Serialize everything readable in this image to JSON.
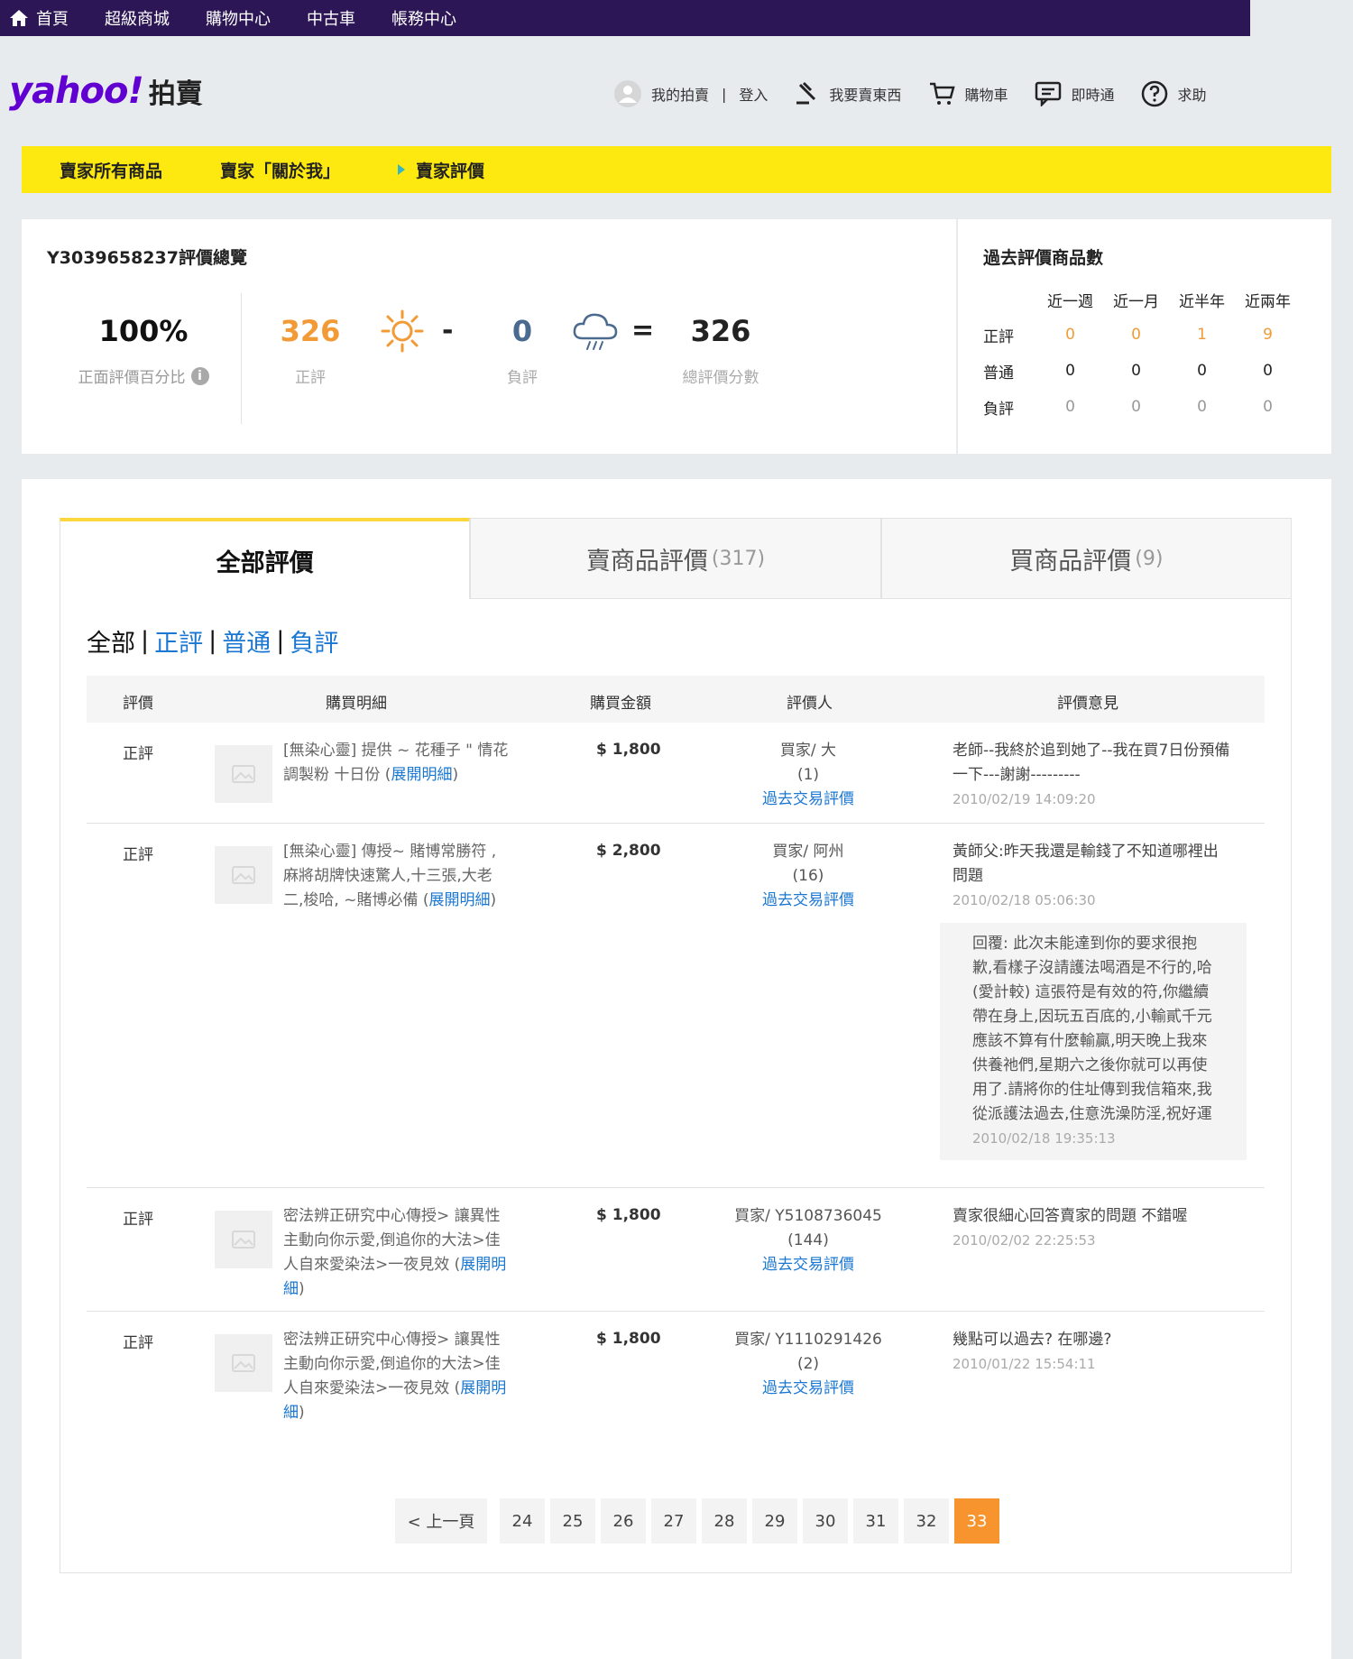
{
  "topnav": {
    "items": [
      "首頁",
      "超級商城",
      "購物中心",
      "中古車",
      "帳務中心"
    ]
  },
  "header": {
    "logo_text": "yahoo!",
    "logo_sub": "拍賣",
    "my_auction": "我的拍賣",
    "login": "登入",
    "sell": "我要賣東西",
    "cart": "購物車",
    "chat": "即時通",
    "help": "求助"
  },
  "seller_nav": {
    "items": [
      "賣家所有商品",
      "賣家「關於我」",
      "賣家評價"
    ]
  },
  "summary": {
    "title": "Y3039658237評價總覽",
    "percent": "100%",
    "percent_label": "正面評價百分比",
    "positive": "326",
    "positive_label": "正評",
    "minus": "-",
    "negative": "0",
    "negative_label": "負評",
    "equals": "=",
    "total": "326",
    "total_label": "總評價分數",
    "accent_color": "#f29b36"
  },
  "past_stats": {
    "title": "過去評價商品數",
    "columns": [
      "近一週",
      "近一月",
      "近半年",
      "近兩年"
    ],
    "rows": [
      {
        "label": "正評",
        "values": [
          "0",
          "0",
          "1",
          "9"
        ]
      },
      {
        "label": "普通",
        "values": [
          "0",
          "0",
          "0",
          "0"
        ]
      },
      {
        "label": "負評",
        "values": [
          "0",
          "0",
          "0",
          "0"
        ]
      }
    ]
  },
  "tabs": {
    "all": "全部評價",
    "sell": "賣商品評價",
    "sell_count": "(317)",
    "buy": "買商品評價",
    "buy_count": "(9)"
  },
  "filter": {
    "all": "全部",
    "positive": "正評",
    "neutral": "普通",
    "negative": "負評"
  },
  "table": {
    "headers": [
      "評價",
      "購買明細",
      "購買金額",
      "評價人",
      "評價意見"
    ],
    "rows": [
      {
        "rating": "正評",
        "desc": "[無染心靈] 提供 ~ 花種子 \" 情花調製粉 十日份 (",
        "expand": "展開明細",
        "desc_end": ")",
        "amount": "$ 1,800",
        "rater": "買家/ 大",
        "rater_count": "(1)",
        "rater_link": "過去交易評價",
        "comment": "老師--我終於追到她了--我在買7日份預備一下---謝謝---------",
        "time": "2010/02/19 14:09:20"
      },
      {
        "rating": "正評",
        "desc": "[無染心靈] 傳授~ 賭博常勝符 , 麻將胡牌快速驚人,十三張,大老二,梭哈, ~賭博必備 (",
        "expand": "展開明細",
        "desc_end": ")",
        "amount": "$ 2,800",
        "rater": "買家/ 阿州",
        "rater_count": "(16)",
        "rater_link": "過去交易評價",
        "comment": "黃師父:昨天我還是輸錢了不知道哪裡出問題",
        "time": "2010/02/18 05:06:30",
        "reply": "回覆: 此次未能達到你的要求很抱歉,看樣子沒請護法喝酒是不行的,哈(愛計較) 這張符是有效的符,你繼續帶在身上,因玩五百底的,小輸貳千元應該不算有什麼輸贏,明天晚上我來供養祂們,星期六之後你就可以再使用了.請將你的住址傳到我信箱來,我從派護法過去,住意洗澡防淫,祝好運",
        "reply_time": "2010/02/18 19:35:13"
      },
      {
        "rating": "正評",
        "desc": "密法辨正研究中心傳授> 讓異性主動向你示愛,倒追你的大法>佳人自來愛染法>一夜見效 (",
        "expand": "展開明細",
        "desc_end": ")",
        "amount": "$ 1,800",
        "rater": "買家/ Y5108736045",
        "rater_count": "(144)",
        "rater_link": "過去交易評價",
        "comment": "賣家很細心回答賣家的問題 不錯喔",
        "time": "2010/02/02 22:25:53"
      },
      {
        "rating": "正評",
        "desc": "密法辨正研究中心傳授> 讓異性主動向你示愛,倒追你的大法>佳人自來愛染法>一夜見效 (",
        "expand": "展開明細",
        "desc_end": ")",
        "amount": "$ 1,800",
        "rater": "買家/ Y1110291426",
        "rater_count": "(2)",
        "rater_link": "過去交易評價",
        "comment": "幾點可以過去? 在哪邊?",
        "time": "2010/01/22 15:54:11"
      }
    ]
  },
  "pager": {
    "prev": "< 上一頁",
    "pages": [
      "24",
      "25",
      "26",
      "27",
      "28",
      "29",
      "30",
      "31",
      "32",
      "33"
    ],
    "current": "33"
  }
}
